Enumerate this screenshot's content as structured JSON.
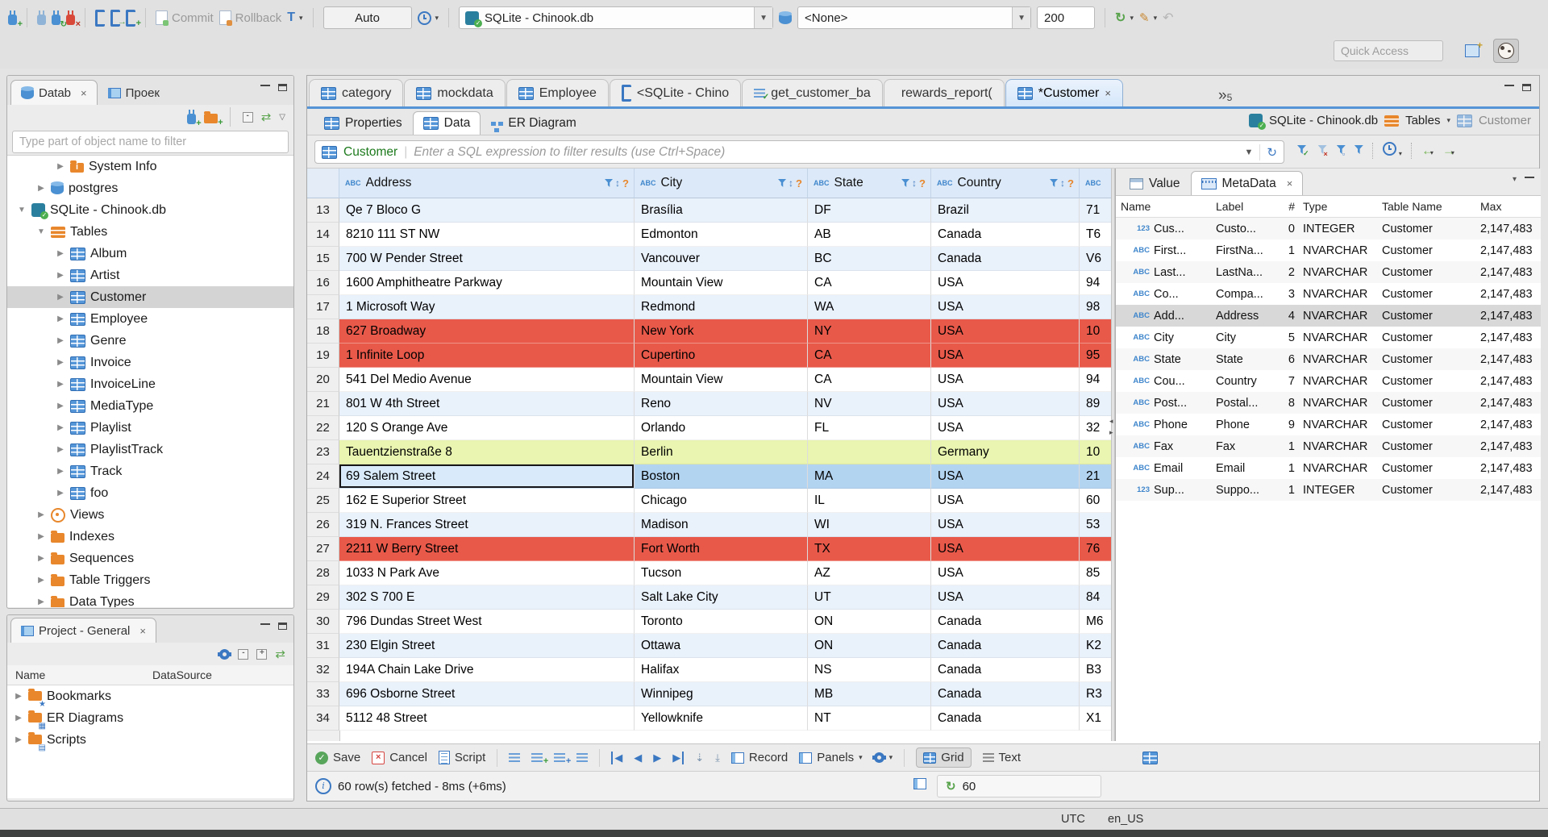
{
  "toolbar": {
    "commit_label": "Commit",
    "rollback_label": "Rollback",
    "auto_value": "Auto",
    "connection_value": "SQLite - Chinook.db",
    "schema_value": "<None>",
    "fetch_size": "200",
    "quick_access_placeholder": "Quick Access"
  },
  "navigator": {
    "tab_database": "Datab",
    "tab_project": "Проек",
    "filter_placeholder": "Type part of object name to filter",
    "tree": [
      {
        "exp": "▶",
        "icon": "ic-infofolder",
        "label": "System Info",
        "cls": "lv2"
      },
      {
        "exp": "▶",
        "icon": "ic-db",
        "label": "postgres",
        "cls": "lv1"
      },
      {
        "exp": "▼",
        "icon": "ic-sqlite",
        "label": "SQLite - Chinook.db",
        "cls": "lv0"
      },
      {
        "exp": "▼",
        "icon": "ic-tfolder",
        "label": "Tables",
        "cls": "lv1"
      },
      {
        "exp": "▶",
        "icon": "ic-table",
        "label": "Album",
        "cls": "lv2"
      },
      {
        "exp": "▶",
        "icon": "ic-table",
        "label": "Artist",
        "cls": "lv2"
      },
      {
        "exp": "▶",
        "icon": "ic-table",
        "label": "Customer",
        "cls": "lv2 sel"
      },
      {
        "exp": "▶",
        "icon": "ic-table",
        "label": "Employee",
        "cls": "lv2"
      },
      {
        "exp": "▶",
        "icon": "ic-table",
        "label": "Genre",
        "cls": "lv2"
      },
      {
        "exp": "▶",
        "icon": "ic-table",
        "label": "Invoice",
        "cls": "lv2"
      },
      {
        "exp": "▶",
        "icon": "ic-table",
        "label": "InvoiceLine",
        "cls": "lv2"
      },
      {
        "exp": "▶",
        "icon": "ic-table",
        "label": "MediaType",
        "cls": "lv2"
      },
      {
        "exp": "▶",
        "icon": "ic-table",
        "label": "Playlist",
        "cls": "lv2"
      },
      {
        "exp": "▶",
        "icon": "ic-table",
        "label": "PlaylistTrack",
        "cls": "lv2"
      },
      {
        "exp": "▶",
        "icon": "ic-table",
        "label": "Track",
        "cls": "lv2"
      },
      {
        "exp": "▶",
        "icon": "ic-table",
        "label": "foo",
        "cls": "lv2"
      },
      {
        "exp": "▶",
        "icon": "ic-eye",
        "label": "Views",
        "cls": "lv1"
      },
      {
        "exp": "▶",
        "icon": "ic-folder",
        "label": "Indexes",
        "cls": "lv1"
      },
      {
        "exp": "▶",
        "icon": "ic-folder",
        "label": "Sequences",
        "cls": "lv1"
      },
      {
        "exp": "▶",
        "icon": "ic-folder",
        "label": "Table Triggers",
        "cls": "lv1"
      },
      {
        "exp": "▶",
        "icon": "ic-folder",
        "label": "Data Types",
        "cls": "lv1"
      }
    ]
  },
  "project_panel": {
    "title": "Project - General",
    "col_name": "Name",
    "col_datasource": "DataSource",
    "items": [
      {
        "exp": "▶",
        "label": "Bookmarks",
        "icon": "ic-folder",
        "ov": "★"
      },
      {
        "exp": "▶",
        "label": "ER Diagrams",
        "icon": "ic-folder",
        "ov": "▦"
      },
      {
        "exp": "▶",
        "label": "Scripts",
        "icon": "ic-folder",
        "ov": "▤"
      }
    ]
  },
  "editor": {
    "tabs": [
      {
        "icon": "ic-table",
        "label": "category"
      },
      {
        "icon": "ic-table",
        "label": "mockdata"
      },
      {
        "icon": "ic-table",
        "label": "Employee"
      },
      {
        "icon": "ic-brk",
        "label": "<SQLite - Chino"
      },
      {
        "icon": "ic-sqlcheck",
        "label": "get_customer_ba"
      },
      {
        "icon": "ic-func",
        "label": "rewards_report("
      },
      {
        "icon": "ic-table",
        "label": "*Customer",
        "cls": "active",
        "close": "×"
      }
    ],
    "overflow_chevron": "»",
    "overflow_count": "5",
    "subtab_properties": "Properties",
    "subtab_data": "Data",
    "subtab_er": "ER Diagram",
    "breadcrumb_db": "SQLite - Chinook.db",
    "breadcrumb_tables": "Tables",
    "breadcrumb_table": "Customer"
  },
  "resultset": {
    "filter_table": "Customer",
    "filter_placeholder": "Enter a SQL expression to filter results (use Ctrl+Space)",
    "columns": [
      {
        "tag": "ABC",
        "name": "Address",
        "w": "w-addr"
      },
      {
        "tag": "ABC",
        "name": "City",
        "w": "w-city"
      },
      {
        "tag": "ABC",
        "name": "State",
        "w": "w-state"
      },
      {
        "tag": "ABC",
        "name": "Country",
        "w": "w-country"
      },
      {
        "tag": "ABC",
        "name": "",
        "w": "w-last",
        "tools": "hide"
      }
    ],
    "rows": [
      {
        "num": "13",
        "cells": [
          "Qe 7 Bloco G",
          "Brasília",
          "DF",
          "Brazil",
          "71"
        ],
        "cls": "rblue"
      },
      {
        "num": "14",
        "cells": [
          "8210 111 ST NW",
          "Edmonton",
          "AB",
          "Canada",
          "T6"
        ],
        "cls": "rwhite"
      },
      {
        "num": "15",
        "cells": [
          "700 W Pender Street",
          "Vancouver",
          "BC",
          "Canada",
          "V6"
        ],
        "cls": "rblue"
      },
      {
        "num": "16",
        "cells": [
          "1600 Amphitheatre Parkway",
          "Mountain View",
          "CA",
          "USA",
          "94"
        ],
        "cls": "rwhite"
      },
      {
        "num": "17",
        "cells": [
          "1 Microsoft Way",
          "Redmond",
          "WA",
          "USA",
          "98"
        ],
        "cls": "rblue"
      },
      {
        "num": "18",
        "cells": [
          "627 Broadway",
          "New York",
          "NY",
          "USA",
          "10"
        ],
        "cls": "rred"
      },
      {
        "num": "19",
        "cells": [
          "1 Infinite Loop",
          "Cupertino",
          "CA",
          "USA",
          "95"
        ],
        "cls": "rred"
      },
      {
        "num": "20",
        "cells": [
          "541 Del Medio Avenue",
          "Mountain View",
          "CA",
          "USA",
          "94"
        ],
        "cls": "rwhite"
      },
      {
        "num": "21",
        "cells": [
          "801 W 4th Street",
          "Reno",
          "NV",
          "USA",
          "89"
        ],
        "cls": "rblue"
      },
      {
        "num": "22",
        "cells": [
          "120 S Orange Ave",
          "Orlando",
          "FL",
          "USA",
          "32"
        ],
        "cls": "rwhite"
      },
      {
        "num": "23",
        "cells": [
          "Tauentzienstraße 8",
          "Berlin",
          "",
          "Germany",
          "10"
        ],
        "cls": "rgreen"
      },
      {
        "num": "24",
        "cells": [
          "69 Salem Street",
          "Boston",
          "MA",
          "USA",
          "21"
        ],
        "cls": "rsel",
        "c0": "cellfocus"
      },
      {
        "num": "25",
        "cells": [
          "162 E Superior Street",
          "Chicago",
          "IL",
          "USA",
          "60"
        ],
        "cls": "rwhite"
      },
      {
        "num": "26",
        "cells": [
          "319 N. Frances Street",
          "Madison",
          "WI",
          "USA",
          "53"
        ],
        "cls": "rblue"
      },
      {
        "num": "27",
        "cells": [
          "2211 W Berry Street",
          "Fort Worth",
          "TX",
          "USA",
          "76"
        ],
        "cls": "rred"
      },
      {
        "num": "28",
        "cells": [
          "1033 N Park Ave",
          "Tucson",
          "AZ",
          "USA",
          "85"
        ],
        "cls": "rwhite"
      },
      {
        "num": "29",
        "cells": [
          "302 S 700 E",
          "Salt Lake City",
          "UT",
          "USA",
          "84"
        ],
        "cls": "rblue"
      },
      {
        "num": "30",
        "cells": [
          "796 Dundas Street West",
          "Toronto",
          "ON",
          "Canada",
          "M6"
        ],
        "cls": "rwhite"
      },
      {
        "num": "31",
        "cells": [
          "230 Elgin Street",
          "Ottawa",
          "ON",
          "Canada",
          "K2"
        ],
        "cls": "rblue"
      },
      {
        "num": "32",
        "cells": [
          "194A Chain Lake Drive",
          "Halifax",
          "NS",
          "Canada",
          "B3"
        ],
        "cls": "rwhite"
      },
      {
        "num": "33",
        "cells": [
          "696 Osborne Street",
          "Winnipeg",
          "MB",
          "Canada",
          "R3"
        ],
        "cls": "rblue"
      },
      {
        "num": "34",
        "cells": [
          "5112 48 Street",
          "Yellowknife",
          "NT",
          "Canada",
          "X1"
        ],
        "cls": "rwhite"
      }
    ]
  },
  "metadata": {
    "tab_value": "Value",
    "tab_metadata": "MetaData",
    "columns": [
      "Name",
      "Label",
      "#",
      "Type",
      "Table Name",
      "Max"
    ],
    "rows": [
      {
        "icon": "123",
        "name": "Cus...",
        "label": "Custo...",
        "num": "0",
        "type": "INTEGER",
        "table": "Customer",
        "max": "2,147,483"
      },
      {
        "icon": "ABC",
        "name": "First...",
        "label": "FirstNa...",
        "num": "1",
        "type": "NVARCHAR",
        "table": "Customer",
        "max": "2,147,483"
      },
      {
        "icon": "ABC",
        "name": "Last...",
        "label": "LastNa...",
        "num": "2",
        "type": "NVARCHAR",
        "table": "Customer",
        "max": "2,147,483"
      },
      {
        "icon": "ABC",
        "name": "Co...",
        "label": "Compa...",
        "num": "3",
        "type": "NVARCHAR",
        "table": "Customer",
        "max": "2,147,483"
      },
      {
        "icon": "ABC",
        "name": "Add...",
        "label": "Address",
        "num": "4",
        "type": "NVARCHAR",
        "table": "Customer",
        "max": "2,147,483",
        "cls": "sel"
      },
      {
        "icon": "ABC",
        "name": "City",
        "label": "City",
        "num": "5",
        "type": "NVARCHAR",
        "table": "Customer",
        "max": "2,147,483"
      },
      {
        "icon": "ABC",
        "name": "State",
        "label": "State",
        "num": "6",
        "type": "NVARCHAR",
        "table": "Customer",
        "max": "2,147,483"
      },
      {
        "icon": "ABC",
        "name": "Cou...",
        "label": "Country",
        "num": "7",
        "type": "NVARCHAR",
        "table": "Customer",
        "max": "2,147,483"
      },
      {
        "icon": "ABC",
        "name": "Post...",
        "label": "Postal...",
        "num": "8",
        "type": "NVARCHAR",
        "table": "Customer",
        "max": "2,147,483"
      },
      {
        "icon": "ABC",
        "name": "Phone",
        "label": "Phone",
        "num": "9",
        "type": "NVARCHAR",
        "table": "Customer",
        "max": "2,147,483"
      },
      {
        "icon": "ABC",
        "name": "Fax",
        "label": "Fax",
        "num": "1",
        "type": "NVARCHAR",
        "table": "Customer",
        "max": "2,147,483"
      },
      {
        "icon": "ABC",
        "name": "Email",
        "label": "Email",
        "num": "1",
        "type": "NVARCHAR",
        "table": "Customer",
        "max": "2,147,483"
      },
      {
        "icon": "123",
        "name": "Sup...",
        "label": "Suppo...",
        "num": "1",
        "type": "INTEGER",
        "table": "Customer",
        "max": "2,147,483"
      }
    ]
  },
  "bottombar": {
    "save": "Save",
    "cancel": "Cancel",
    "script": "Script",
    "record": "Record",
    "panels": "Panels",
    "grid": "Grid",
    "text": "Text"
  },
  "statusbar": {
    "fetch_message": "60 row(s) fetched - 8ms (+6ms)",
    "refresh_count": "60"
  },
  "window_statusbar": {
    "timezone": "UTC",
    "locale": "en_US"
  },
  "colors": {
    "accent_blue": "#3b78c2",
    "row_red": "#e8594a",
    "row_green": "#e9f5b0",
    "row_selected": "#b3d4f1",
    "folder_orange": "#e8872c"
  }
}
